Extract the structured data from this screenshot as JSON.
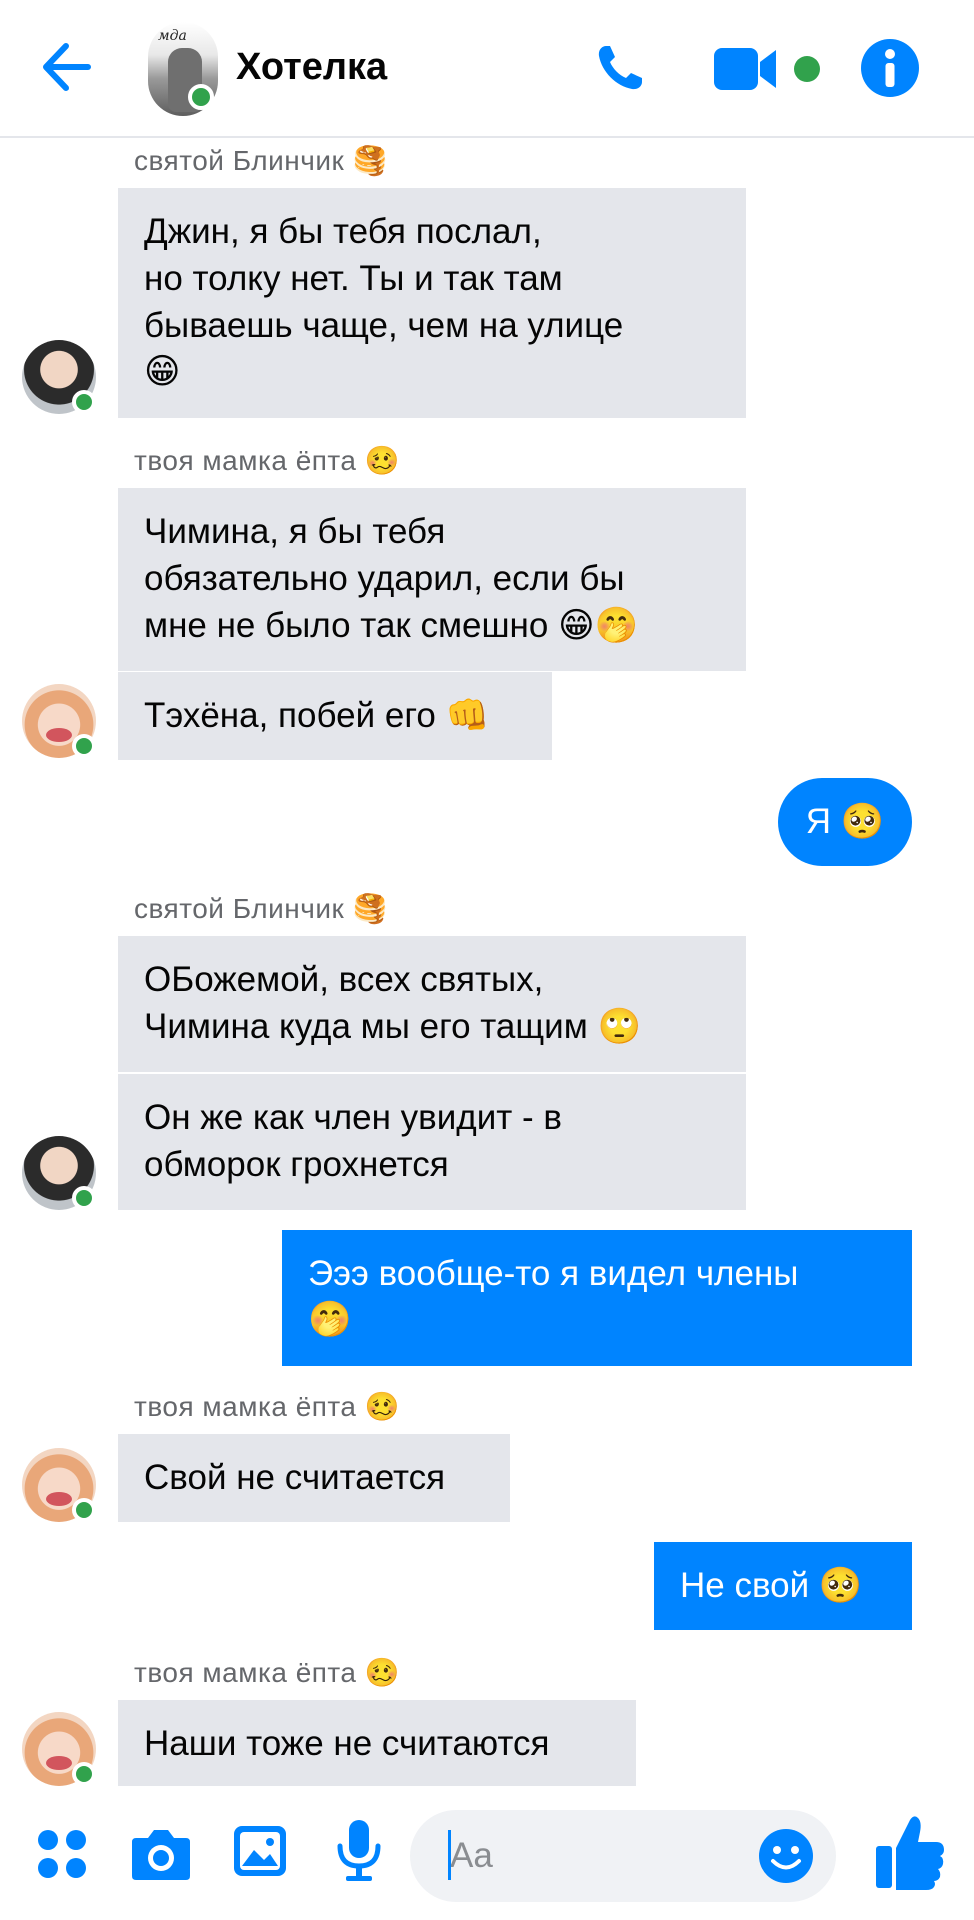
{
  "header": {
    "title": "Хотелка",
    "avatar_caption": "мда",
    "icons": [
      "back-arrow-icon",
      "phone-icon",
      "video-camera-icon",
      "info-icon"
    ]
  },
  "colors": {
    "accent": "#0084ff",
    "online": "#31a24c",
    "incoming_bubble": "#e4e6eb",
    "meta_text": "#65676b"
  },
  "messages": [
    {
      "kind": "sender",
      "text": "святой Блинчик 🥞"
    },
    {
      "kind": "in",
      "lines": [
        "Джин, я бы тебя послал,",
        "но толку нет. Ты и так там",
        "бываешь чаще, чем на улице",
        "😁"
      ]
    },
    {
      "kind": "sender",
      "text": "твоя мамка ёпта 🥴"
    },
    {
      "kind": "in",
      "lines": [
        "Чимина, я бы тебя",
        "обязательно ударил, если бы",
        "мне не было так смешно 😁🤭"
      ]
    },
    {
      "kind": "in",
      "lines": [
        "Тэхёна, побей его 👊"
      ]
    },
    {
      "kind": "out",
      "lines": [
        "Я 🥺"
      ]
    },
    {
      "kind": "sender",
      "text": "святой Блинчик 🥞"
    },
    {
      "kind": "in",
      "lines": [
        "ОБожемой, всех святых,",
        "Чимина куда мы его тащим 🙄"
      ]
    },
    {
      "kind": "in",
      "lines": [
        "Он же как член увидит - в",
        "обморок грохнется"
      ]
    },
    {
      "kind": "out",
      "lines": [
        "Эээ вообще-то я видел члены",
        "🤭"
      ]
    },
    {
      "kind": "sender",
      "text": "твоя мамка ёпта 🥴"
    },
    {
      "kind": "in",
      "lines": [
        "Свой не считается"
      ]
    },
    {
      "kind": "out",
      "lines": [
        "Не свой 🥺"
      ]
    },
    {
      "kind": "sender",
      "text": "твоя мамка ёпта 🥴"
    },
    {
      "kind": "in",
      "lines": [
        "Наши тоже не считаются"
      ]
    }
  ],
  "composer": {
    "placeholder": "Aa",
    "icons": [
      "apps-icon",
      "camera-icon",
      "gallery-icon",
      "microphone-icon",
      "emoji-icon",
      "like-thumb-icon"
    ]
  }
}
